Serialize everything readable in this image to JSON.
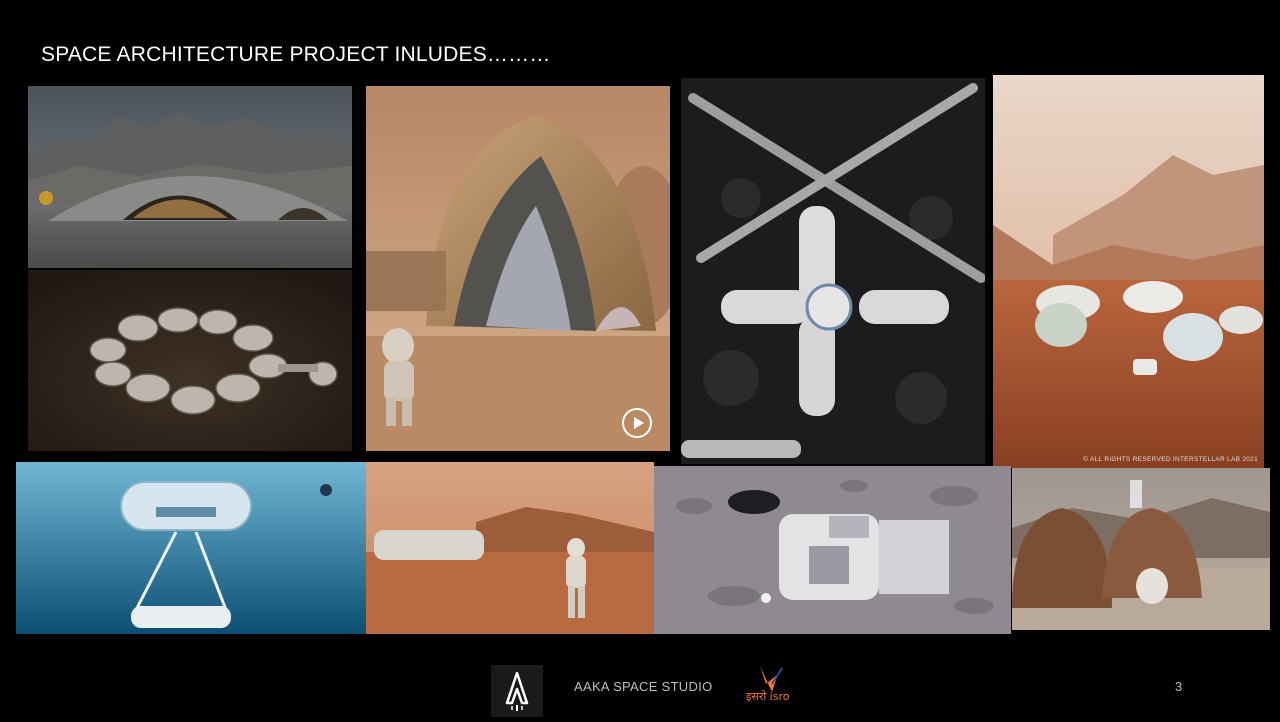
{
  "slide": {
    "title": "SPACE ARCHITECTURE PROJECT INLUDES………",
    "page_number": "3"
  },
  "images": {
    "copyright_caption": "© ALL RIGHTS RESERVED INTERSTELLAR LAB 2021"
  },
  "footer": {
    "studio_name": "AAKA SPACE STUDIO",
    "isro_logo_text": "इसरो isro"
  },
  "colors": {
    "background": "#000000",
    "footer_text": "#bdbdbd",
    "isro_orange": "#f47c20",
    "isro_blue": "#1e4fa3"
  }
}
